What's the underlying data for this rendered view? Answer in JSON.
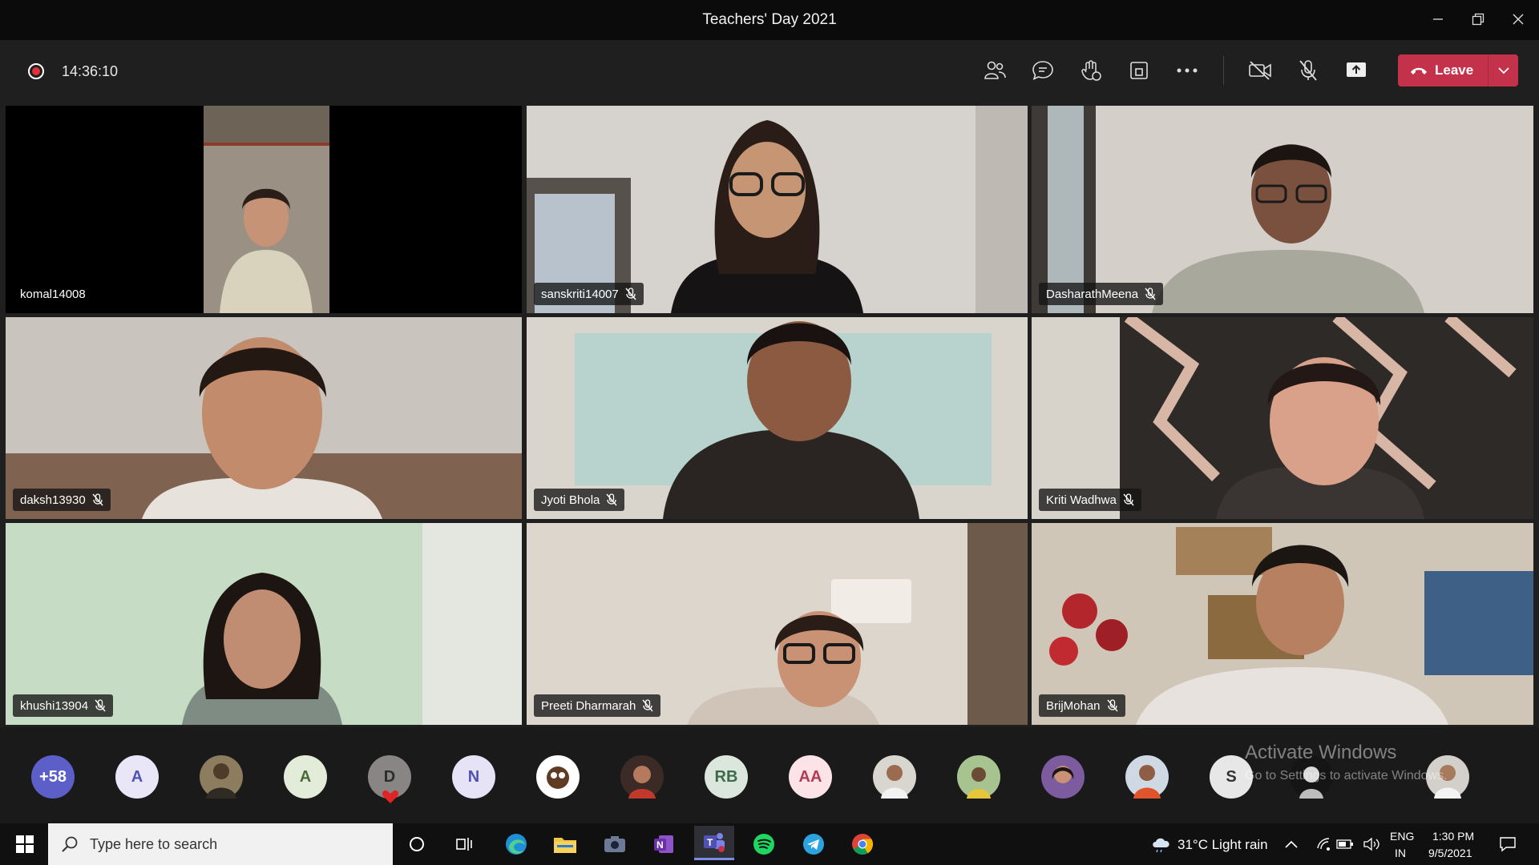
{
  "window": {
    "title": "Teachers' Day 2021"
  },
  "toolbar": {
    "recording_time": "14:36:10",
    "leave_label": "Leave"
  },
  "tiles": [
    {
      "name": "komal14008",
      "muted": false
    },
    {
      "name": "sanskriti14007",
      "muted": true
    },
    {
      "name": "DasharathMeena",
      "muted": true
    },
    {
      "name": "daksh13930",
      "muted": true
    },
    {
      "name": "Jyoti Bhola",
      "muted": true
    },
    {
      "name": "Kriti Wadhwa",
      "muted": true
    },
    {
      "name": "khushi13904",
      "muted": true
    },
    {
      "name": "Preeti Dharmarah",
      "muted": true
    },
    {
      "name": "BrijMohan",
      "muted": true
    }
  ],
  "participants_strip": {
    "overflow_count": "+58",
    "initials": [
      "A",
      "A",
      "D",
      "N",
      "RB",
      "AA",
      "S"
    ]
  },
  "watermark": {
    "title": "Activate Windows",
    "subtitle": "Go to Settings to activate Windows."
  },
  "taskbar": {
    "search_placeholder": "Type here to search",
    "weather": "31°C  Light rain",
    "lang_top": "ENG",
    "lang_bottom": "IN",
    "time": "1:30 PM",
    "date": "9/5/2021"
  },
  "colors": {
    "leave": "#c4314b",
    "record": "#e0303a",
    "overflow_avatar": "#5b5fc7"
  }
}
